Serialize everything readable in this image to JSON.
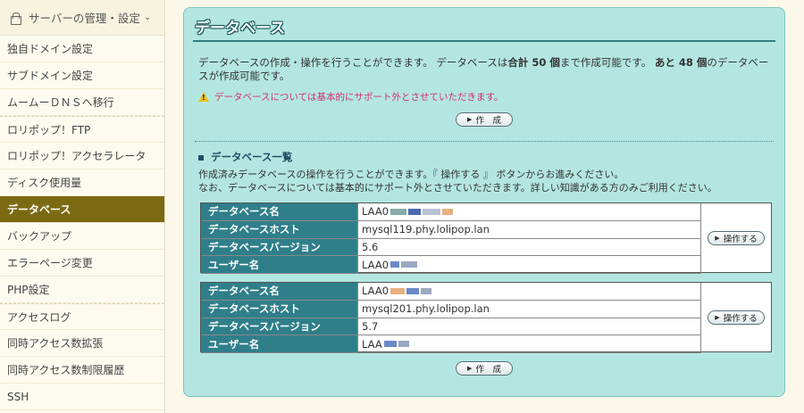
{
  "sidebar": {
    "header": "サーバーの管理・設定",
    "items": [
      {
        "label": "独自ドメイン設定"
      },
      {
        "label": "サブドメイン設定"
      },
      {
        "label": "ムームーＤＮＳへ移行"
      },
      {
        "label": "ロリポップ！FTP"
      },
      {
        "label": "ロリポップ！アクセラレータ"
      },
      {
        "label": "ディスク使用量"
      },
      {
        "label": "データベース"
      },
      {
        "label": "バックアップ"
      },
      {
        "label": "エラーページ変更"
      },
      {
        "label": "PHP設定"
      },
      {
        "label": "アクセスログ"
      },
      {
        "label": "同時アクセス数拡張"
      },
      {
        "label": "同時アクセス数制限履歴"
      },
      {
        "label": "SSH"
      }
    ]
  },
  "main": {
    "title": "データベース",
    "intro_part1": "データベースの作成・操作を行うことができます。 データベースは",
    "intro_bold1": "合計 50 個",
    "intro_part2": "まで作成可能です。",
    "intro_bold2": "あと 48 個",
    "intro_part3": "のデータベースが作成可能です。",
    "warning": "データベースについては基本的にサポート外とさせていただきます。",
    "create_label": "作　成",
    "list_heading": "データベース一覧",
    "list_desc_line1": "作成済みデータベースの操作を行うことができます。『 操作する 』 ボタンからお進みください。",
    "list_desc_line2": "なお、データベースについては基本的にサポート外とさせていただきます。詳しい知識がある方のみご利用ください。",
    "operate_label": "操作する",
    "databases": [
      {
        "name_label": "データベース名",
        "name": "LAA0",
        "host_label": "データベースホスト",
        "host": "mysql119.phy.lolipop.lan",
        "version_label": "データベースバージョン",
        "version": "5.6",
        "user_label": "ユーザー名",
        "user": "LAA0"
      },
      {
        "name_label": "データベース名",
        "name": "LAA0",
        "host_label": "データベースホスト",
        "host": "mysql201.phy.lolipop.lan",
        "version_label": "データベースバージョン",
        "version": "5.7",
        "user_label": "ユーザー名",
        "user": "LAA"
      }
    ]
  }
}
